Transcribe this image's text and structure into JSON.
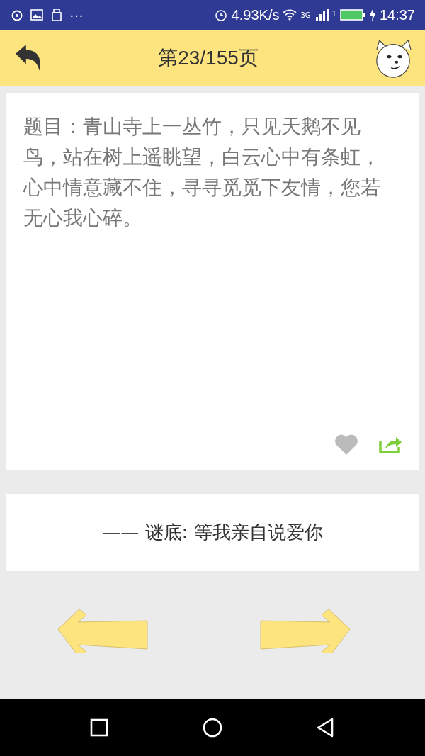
{
  "status_bar": {
    "more": "···",
    "speed": "4.93K/s",
    "network": "3G",
    "sim": "1",
    "time": "14:37"
  },
  "header": {
    "title": "第23/155页"
  },
  "riddle": {
    "text": "题目：青山寺上一丛竹，只见天鹅不见鸟，站在树上遥眺望，白云心中有条虹，心中情意藏不住，寻寻觅觅下友情，您若无心我心碎。",
    "liked": false
  },
  "answer": {
    "text": "—— 谜底: 等我亲自说爱你"
  }
}
